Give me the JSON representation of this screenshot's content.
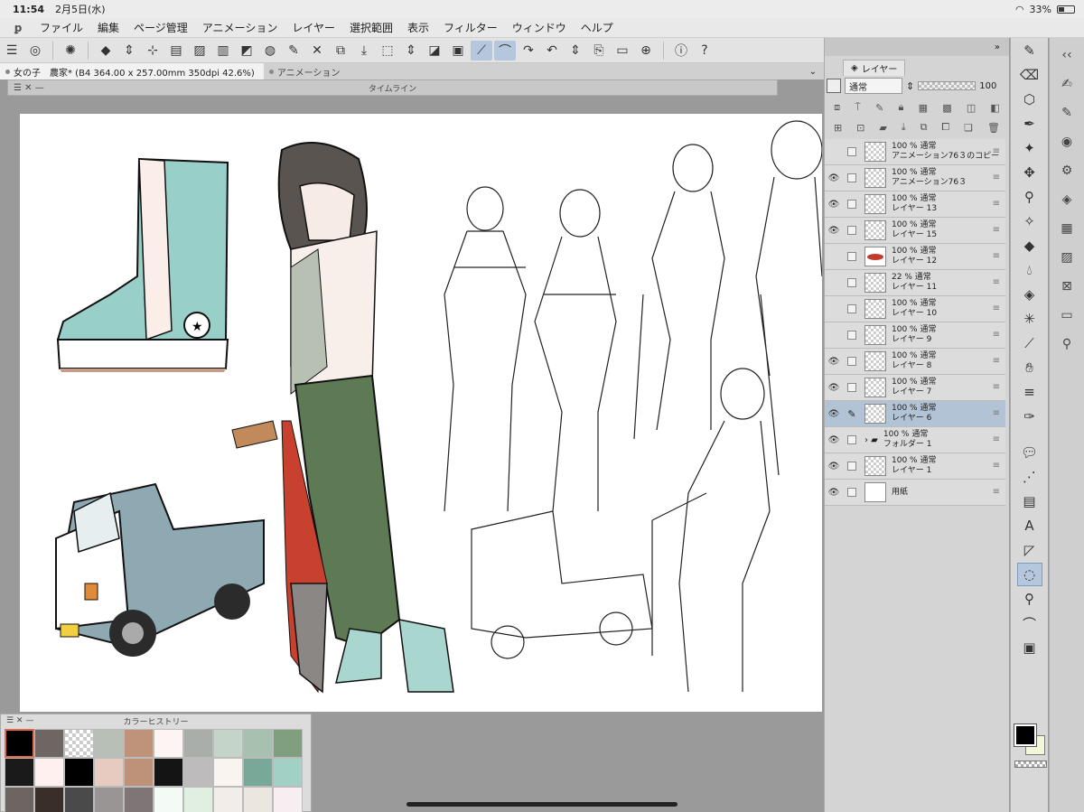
{
  "status": {
    "time": "11:54",
    "date": "2月5日(水)",
    "battery": "33%"
  },
  "menu": [
    "ファイル",
    "編集",
    "ページ管理",
    "アニメーション",
    "レイヤー",
    "選択範囲",
    "表示",
    "フィルター",
    "ウィンドウ",
    "ヘルプ"
  ],
  "tabs": [
    {
      "label": "女の子　農家* (B4 364.00 x 257.00mm 350dpi 42.6%)",
      "active": true
    },
    {
      "label": "アニメーション",
      "active": false
    }
  ],
  "timeline": {
    "title": "タイムライン"
  },
  "layer_panel": {
    "tab_label": "レイヤー",
    "blend_mode": "通常",
    "opacity": "100",
    "layers": [
      {
        "visible": false,
        "opacity_mode": "100 % 通常",
        "name": "アニメーション76３のコピー",
        "thumb": "sketch",
        "selected": false
      },
      {
        "visible": true,
        "opacity_mode": "100 % 通常",
        "name": "アニメーション76３",
        "thumb": "sketch",
        "selected": false
      },
      {
        "visible": true,
        "opacity_mode": "100 % 通常",
        "name": "レイヤー 13",
        "thumb": "sketch",
        "selected": false
      },
      {
        "visible": true,
        "opacity_mode": "100 % 通常",
        "name": "レイヤー 15",
        "thumb": "sketch",
        "selected": false
      },
      {
        "visible": false,
        "opacity_mode": "100 % 通常",
        "name": "レイヤー 12",
        "thumb": "red",
        "selected": false
      },
      {
        "visible": false,
        "opacity_mode": "22 % 通常",
        "name": "レイヤー 11",
        "thumb": "sketch",
        "selected": false
      },
      {
        "visible": false,
        "opacity_mode": "100 % 通常",
        "name": "レイヤー 10",
        "thumb": "sketch",
        "selected": false
      },
      {
        "visible": false,
        "opacity_mode": "100 % 通常",
        "name": "レイヤー 9",
        "thumb": "sketch",
        "selected": false
      },
      {
        "visible": true,
        "opacity_mode": "100 % 通常",
        "name": "レイヤー 8",
        "thumb": "sketch",
        "selected": false
      },
      {
        "visible": true,
        "opacity_mode": "100 % 通常",
        "name": "レイヤー 7",
        "thumb": "sketch",
        "selected": false
      },
      {
        "visible": true,
        "opacity_mode": "100 % 通常",
        "name": "レイヤー 6",
        "thumb": "sketch",
        "selected": true
      },
      {
        "visible": true,
        "opacity_mode": "100 % 通常",
        "name": "フォルダー 1",
        "thumb": "folder",
        "selected": false
      },
      {
        "visible": true,
        "opacity_mode": "100 % 通常",
        "name": "レイヤー 1",
        "thumb": "sketch",
        "selected": false
      },
      {
        "visible": true,
        "opacity_mode": "",
        "name": "用紙",
        "thumb": "paper",
        "selected": false
      }
    ]
  },
  "color_history": {
    "title": "カラーヒストリー",
    "swatches": [
      "#000000",
      "#6e6663",
      "transparent",
      "#b7bfb6",
      "#bf927a",
      "#fdf5f3",
      "#a9aeaa",
      "#c4d4c9",
      "#a8c0b0",
      "#7f9f7e",
      "#1a1a1a",
      "#fdf0ef",
      "#000000",
      "#e8cbc0",
      "#bd9278",
      "#141414",
      "#bdbbbb",
      "#f9f4f0",
      "#78a898",
      "#a1d1c5",
      "#6d6561",
      "#3a2e2a",
      "#4a4a4a",
      "#9a9595",
      "#7f7577",
      "#f4fbf6",
      "#e0efe0",
      "#f2ede9",
      "#ece6e0",
      "#f6eef0"
    ]
  },
  "colors": {
    "foreground": "#000000",
    "background": "#f1f8d9",
    "selection": "#b3c3d6"
  }
}
